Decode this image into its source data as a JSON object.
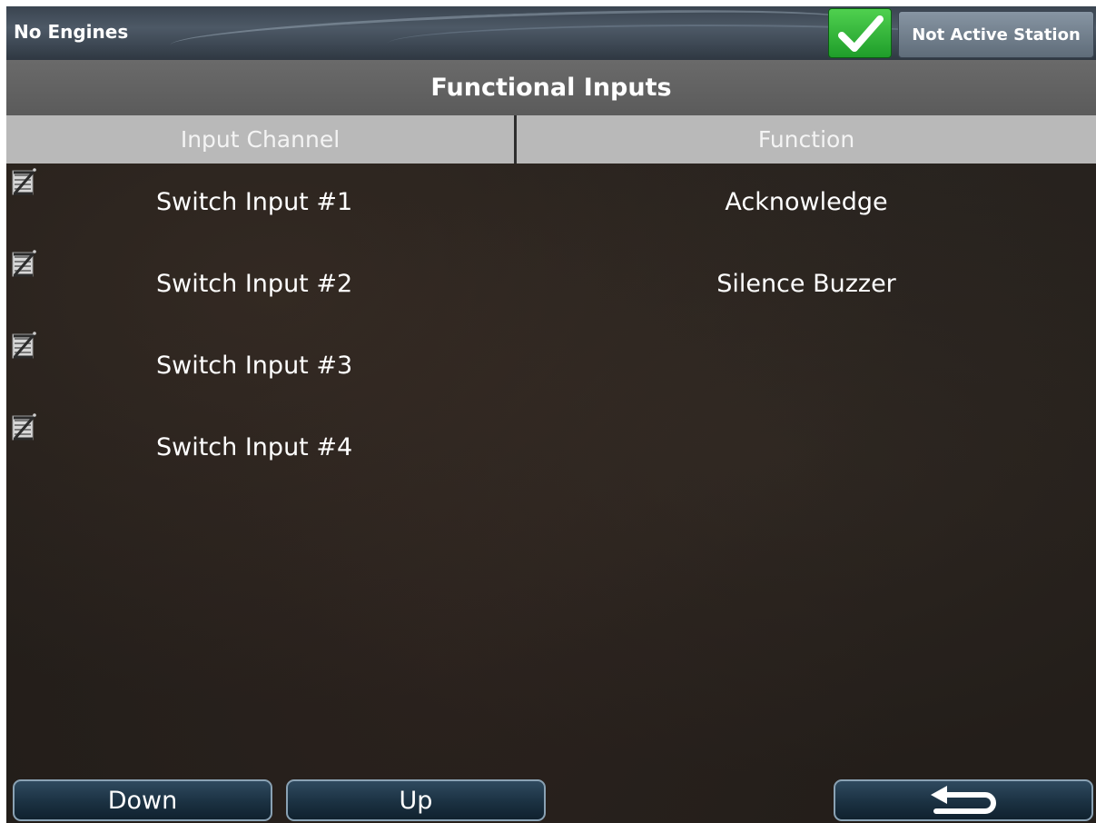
{
  "status_bar": {
    "engine_status": "No Engines",
    "check_icon": "check-icon",
    "check_color": "#2fb53a",
    "station_label": "Not Active Station"
  },
  "page": {
    "title": "Functional Inputs"
  },
  "table": {
    "columns": [
      "Input Channel",
      "Function"
    ],
    "rows": [
      {
        "icon": "edit-icon",
        "channel": "Switch Input #1",
        "function": "Acknowledge"
      },
      {
        "icon": "edit-icon",
        "channel": "Switch Input #2",
        "function": "Silence Buzzer"
      },
      {
        "icon": "edit-icon",
        "channel": "Switch Input #3",
        "function": ""
      },
      {
        "icon": "edit-icon",
        "channel": "Switch Input #4",
        "function": ""
      }
    ]
  },
  "footer": {
    "down_label": "Down",
    "up_label": "Up",
    "back_icon": "back-arrow-icon"
  }
}
